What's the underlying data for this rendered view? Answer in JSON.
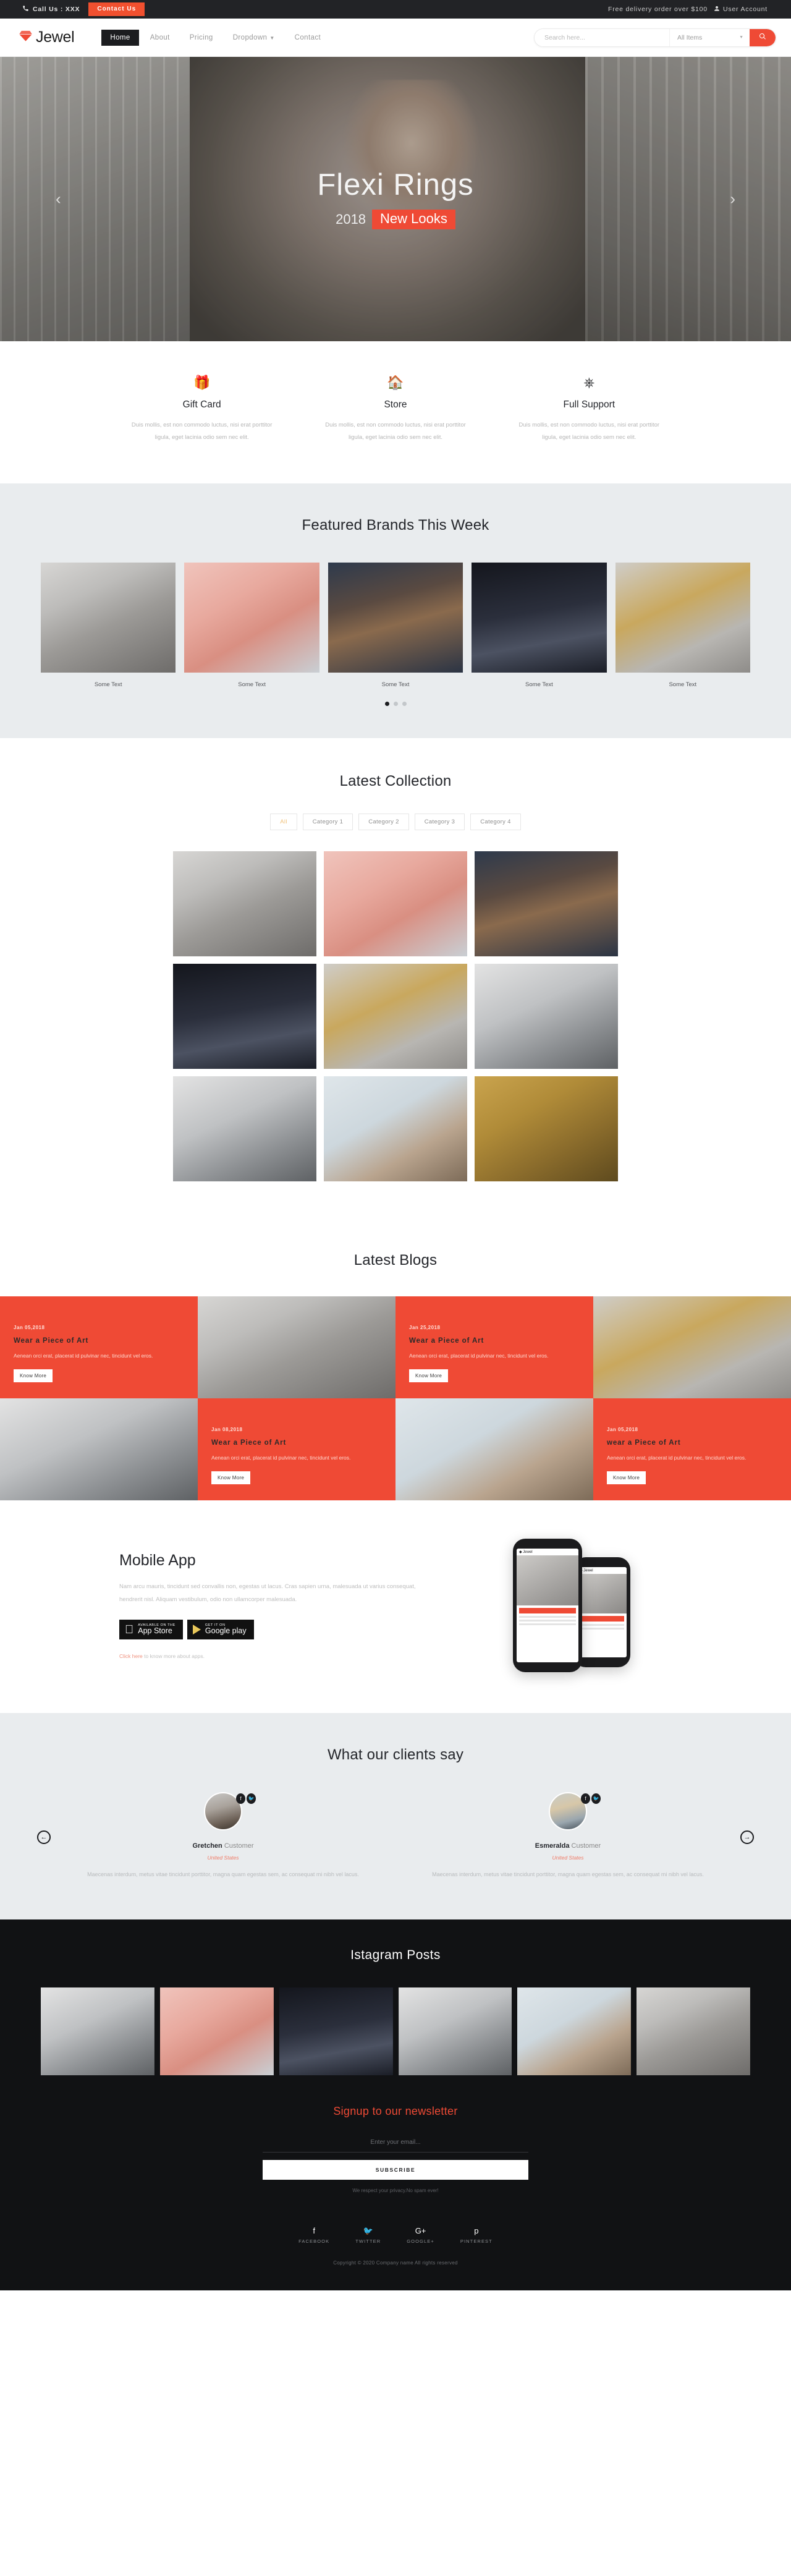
{
  "topbar": {
    "phone_icon": "phone-icon",
    "call_label": "Call Us : XXX",
    "contact_button": "Contact Us",
    "delivery_note": "Free delivery order over $100",
    "user_icon": "user-icon",
    "account_label": "User Account"
  },
  "nav": {
    "brand": "Jewel",
    "brand_icon": "diamond-icon",
    "links": [
      {
        "label": "Home",
        "active": true
      },
      {
        "label": "About",
        "active": false
      },
      {
        "label": "Pricing",
        "active": false
      },
      {
        "label": "Dropdown",
        "active": false,
        "caret": "▼"
      },
      {
        "label": "Contact",
        "active": false
      }
    ],
    "search": {
      "placeholder": "Search here...",
      "value": "",
      "category": "All Items",
      "caret": "▼",
      "button_icon": "search-icon"
    }
  },
  "hero": {
    "title": "Flexi Rings",
    "year": "2018",
    "badge": "New Looks",
    "prev_icon": "‹",
    "next_icon": "›"
  },
  "features": [
    {
      "icon": "🎁",
      "icon_name": "gift-icon",
      "title": "Gift Card",
      "text": "Duis mollis, est non commodo luctus, nisi erat porttitor ligula, eget lacinia odio sem nec elit."
    },
    {
      "icon": "🏠",
      "icon_name": "home-icon",
      "title": "Store",
      "text": "Duis mollis, est non commodo luctus, nisi erat porttitor ligula, eget lacinia odio sem nec elit."
    },
    {
      "icon": "⎈",
      "icon_name": "lifebuoy-icon",
      "title": "Full Support",
      "text": "Duis mollis, est non commodo luctus, nisi erat porttitor ligula, eget lacinia odio sem nec elit."
    }
  ],
  "brands": {
    "title": "Featured Brands This Week",
    "items": [
      {
        "label": "Some Text",
        "img": "img-neck"
      },
      {
        "label": "Some Text",
        "img": "img-pink"
      },
      {
        "label": "Some Text",
        "img": "img-navy"
      },
      {
        "label": "Some Text",
        "img": "img-watch"
      },
      {
        "label": "Some Text",
        "img": "img-gold2"
      }
    ],
    "dots": [
      true,
      false,
      false
    ]
  },
  "collection": {
    "title": "Latest Collection",
    "categories": [
      {
        "label": "All",
        "active": true
      },
      {
        "label": "Category 1",
        "active": false
      },
      {
        "label": "Category 2",
        "active": false
      },
      {
        "label": "Category 3",
        "active": false
      },
      {
        "label": "Category 4",
        "active": false
      }
    ],
    "items": [
      "img-neck",
      "img-pink",
      "img-navy",
      "img-watch",
      "img-gold2",
      "img-diamond",
      "img-diamond",
      "img-hand",
      "img-chain"
    ]
  },
  "blogs": {
    "title": "Latest Blogs",
    "posts": [
      {
        "date": "Jan 05,2018",
        "title": "Wear a Piece of Art",
        "desc": "Aenean orci erat, placerat id pulvinar nec, tincidunt vel eros.",
        "button": "Know More"
      },
      {
        "date": "Jan 25,2018",
        "title": "Wear a Piece of Art",
        "desc": "Aenean orci erat, placerat id pulvinar nec, tincidunt vel eros.",
        "button": "Know More"
      },
      {
        "date": "Jan 08,2018",
        "title": "Wear a Piece of Art",
        "desc": "Aenean orci erat, placerat id pulvinar nec, tincidunt vel eros.",
        "button": "Know More"
      },
      {
        "date": "Jan 05,2018",
        "title": "wear a Piece of Art",
        "desc": "Aenean orci erat, placerat id pulvinar nec, tincidunt vel eros.",
        "button": "Know More"
      }
    ]
  },
  "mobile": {
    "title": "Mobile App",
    "text": "Nam arcu mauris, tincidunt sed convallis non, egestas ut lacus. Cras sapien urna, malesuada ut varius consequat, hendrerit nisl. Aliquam vestibulum, odio non ullamcorper malesuada.",
    "appstore": {
      "small": "AVAILABLE ON THE",
      "big": "App Store",
      "icon": "apple-icon"
    },
    "googleplay": {
      "small": "GET IT ON",
      "big": "Google play",
      "icon": "play-icon"
    },
    "note_link": "Click here",
    "note_rest": " to know more about apps."
  },
  "testimonials": {
    "title": "What our clients say",
    "prev_icon": "←",
    "next_icon": "→",
    "items": [
      {
        "name": "Gretchen",
        "role": "Customer",
        "country": "United States",
        "quote": "Maecenas interdum, metus vitae tincidunt porttitor, magna quam egestas sem, ac consequat mi nibh vel lacus.",
        "avatar": "ava-m",
        "social": [
          "f",
          "🐦"
        ]
      },
      {
        "name": "Esmeralda",
        "role": "Customer",
        "country": "United States",
        "quote": "Maecenas interdum, metus vitae tincidunt porttitor, magna quam egestas sem, ac consequat mi nibh vel lacus.",
        "avatar": "ava-f",
        "social": [
          "f",
          "🐦"
        ]
      }
    ]
  },
  "instagram": {
    "title": "Istagram Posts",
    "items": [
      "img-diamond",
      "img-pink",
      "img-watch",
      "img-diamond",
      "img-hand",
      "img-neck"
    ]
  },
  "newsletter": {
    "title": "Signup to our newsletter",
    "placeholder": "Enter your email...",
    "value": "",
    "button": "SUBSCRIBE",
    "privacy": "We respect your privacy.No spam ever!"
  },
  "footer": {
    "socials": [
      {
        "glyph": "f",
        "label": "FACEBOOK",
        "name": "facebook-icon"
      },
      {
        "glyph": "🐦",
        "label": "TWITTER",
        "name": "twitter-icon"
      },
      {
        "glyph": "G+",
        "label": "GOOGLE+",
        "name": "googleplus-icon"
      },
      {
        "glyph": "p",
        "label": "PINTEREST",
        "name": "pinterest-icon"
      }
    ],
    "copyright": "Copyright © 2020 Company name All rights reserved"
  },
  "colors": {
    "accent": "#ef4a35",
    "dark": "#111214",
    "navdark": "#1c1d20",
    "gray_bg": "#e9ecee"
  }
}
